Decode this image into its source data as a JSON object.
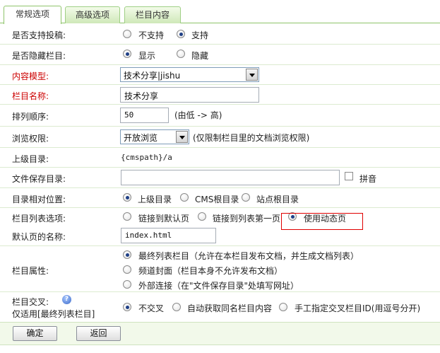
{
  "tabs": [
    "常规选项",
    "高级选项",
    "栏目内容"
  ],
  "rows": {
    "allow_submit": {
      "label": "是否支持投稿:",
      "options": [
        "不支持",
        "支持"
      ]
    },
    "hide_column": {
      "label": "是否隐藏栏目:",
      "options": [
        "显示",
        "隐藏"
      ]
    },
    "content_model": {
      "label": "内容模型:",
      "value": "技术分享|jishu"
    },
    "column_name": {
      "label": "栏目名称:",
      "value": "技术分享"
    },
    "sort_order": {
      "label": "排列顺序:",
      "value": "50",
      "hint": "(由低 -> 高)"
    },
    "browse_perm": {
      "label": "浏览权限:",
      "value": "开放浏览",
      "hint": "(仅限制栏目里的文档浏览权限)"
    },
    "parent_dir": {
      "label": "上级目录:",
      "value": "{cmspath}/a"
    },
    "save_dir": {
      "label": "文件保存目录:",
      "value": "",
      "pinyin": "拼音"
    },
    "relative_pos": {
      "label": "目录相对位置:",
      "options": [
        "上级目录",
        "CMS根目录",
        "站点根目录"
      ]
    },
    "list_option": {
      "label": "栏目列表选项:",
      "options": [
        "链接到默认页",
        "链接到列表第一页",
        "使用动态页"
      ]
    },
    "default_page": {
      "label": "默认页的名称:",
      "value": "index.html"
    },
    "column_attr": {
      "label": "栏目属性:",
      "options": [
        "最终列表栏目（允许在本栏目发布文档，并生成文档列表）",
        "频道封面（栏目本身不允许发布文档）",
        "外部连接（在\"文件保存目录\"处填写网址）"
      ]
    },
    "cross": {
      "label": "栏目交叉:",
      "sublabel": "仅适用[最终列表栏目]",
      "help": "?",
      "options": [
        "不交叉",
        "自动获取同名栏目内容",
        "手工指定交叉栏目ID(用逗号分开)"
      ]
    }
  },
  "buttons": {
    "confirm": "确定",
    "back": "返回"
  },
  "colors": {
    "tab_green": "#cfe8b9",
    "required_label": "#cc0000",
    "highlight_box": "#e00000"
  }
}
